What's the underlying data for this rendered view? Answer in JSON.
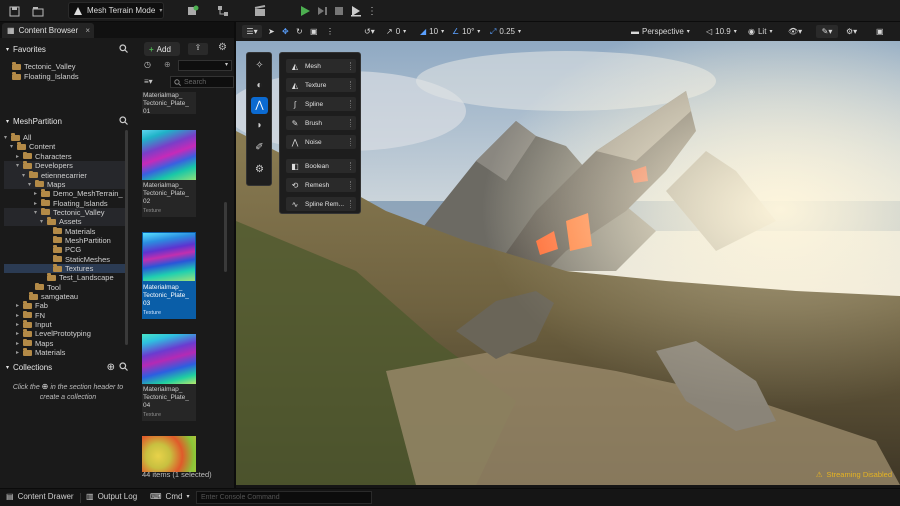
{
  "toolbar": {
    "mode_label": "Mesh Terrain Mode",
    "icons": [
      "save-icon",
      "content-icon",
      "mode-icon",
      "add-actor-icon",
      "blueprint-icon",
      "cinematics-icon",
      "play-icon",
      "step-icon",
      "stop-icon",
      "eject-icon",
      "more-icon"
    ]
  },
  "content_browser": {
    "tab_label": "Content Browser",
    "favorites_label": "Favorites",
    "favorites": [
      "Tectonic_Valley",
      "Floating_Islands"
    ],
    "tree_header": "MeshPartition",
    "tree": [
      {
        "label": "All",
        "depth": 0,
        "arrow": "▾"
      },
      {
        "label": "Content",
        "depth": 1,
        "arrow": "▾"
      },
      {
        "label": "Characters",
        "depth": 2,
        "arrow": "▸"
      },
      {
        "label": "Developers",
        "depth": 2,
        "arrow": "▾"
      },
      {
        "label": "etiennecarrier",
        "depth": 3,
        "arrow": "▾"
      },
      {
        "label": "Maps",
        "depth": 4,
        "arrow": "▾"
      },
      {
        "label": "Demo_MeshTerrain_",
        "depth": 5,
        "arrow": "▸"
      },
      {
        "label": "Floating_Islands",
        "depth": 5,
        "arrow": "▸"
      },
      {
        "label": "Tectonic_Valley",
        "depth": 5,
        "arrow": "▾"
      },
      {
        "label": "Assets",
        "depth": 6,
        "arrow": "▾"
      },
      {
        "label": "Materials",
        "depth": 7,
        "arrow": ""
      },
      {
        "label": "MeshPartition",
        "depth": 7,
        "arrow": ""
      },
      {
        "label": "PCG",
        "depth": 7,
        "arrow": ""
      },
      {
        "label": "StaticMeshes",
        "depth": 7,
        "arrow": ""
      },
      {
        "label": "Textures",
        "depth": 7,
        "arrow": ""
      },
      {
        "label": "Test_Landscape",
        "depth": 6,
        "arrow": ""
      },
      {
        "label": "Tool",
        "depth": 4,
        "arrow": ""
      },
      {
        "label": "samgateau",
        "depth": 3,
        "arrow": ""
      },
      {
        "label": "Fab",
        "depth": 2,
        "arrow": "▸"
      },
      {
        "label": "FN",
        "depth": 2,
        "arrow": "▸"
      },
      {
        "label": "Input",
        "depth": 2,
        "arrow": "▸"
      },
      {
        "label": "LevelPrototyping",
        "depth": 2,
        "arrow": "▸"
      },
      {
        "label": "Maps",
        "depth": 2,
        "arrow": "▸"
      },
      {
        "label": "Materials",
        "depth": 2,
        "arrow": "▸"
      }
    ],
    "collections_label": "Collections",
    "collections_hint_pre": "Click the",
    "collections_hint_post": "in the section header to create a collection",
    "add_label": "Add",
    "search_placeholder": "Search",
    "assets": [
      {
        "line1": "Materialmap_",
        "line2": "Tectonic_Plate_",
        "line3": "01",
        "type": "",
        "selected": false
      },
      {
        "line1": "Materialmap_",
        "line2": "Tectonic_Plate_",
        "line3": "02",
        "type": "Texture",
        "selected": false
      },
      {
        "line1": "Materialmap_",
        "line2": "Tectonic_Plate_",
        "line3": "03",
        "type": "Texture",
        "selected": true
      },
      {
        "line1": "Materialmap_",
        "line2": "Tectonic_Plate_",
        "line3": "04",
        "type": "Texture",
        "selected": false
      }
    ],
    "item_count": "44 items (1 selected)"
  },
  "viewport_toolbar": {
    "snap_translate": "0",
    "snap_grid": "10",
    "snap_rotate": "10°",
    "snap_scale": "0.25",
    "perspective_label": "Perspective",
    "fov": "10.9",
    "lit_label": "Lit"
  },
  "terrain_menu": [
    "Mesh",
    "Texture",
    "Spline",
    "Brush",
    "Noise",
    "Boolean",
    "Remesh",
    "Spline Rem..."
  ],
  "status": {
    "streaming": "Streaming Disabled"
  },
  "statusbar": {
    "drawer": "Content Drawer",
    "output": "Output Log",
    "cmd": "Cmd",
    "console_placeholder": "Enter Console Command"
  },
  "colors": {
    "accent": "#0b6ad1",
    "selection": "#0a5ea8",
    "play": "#4caf50",
    "warning": "#e6b422"
  }
}
